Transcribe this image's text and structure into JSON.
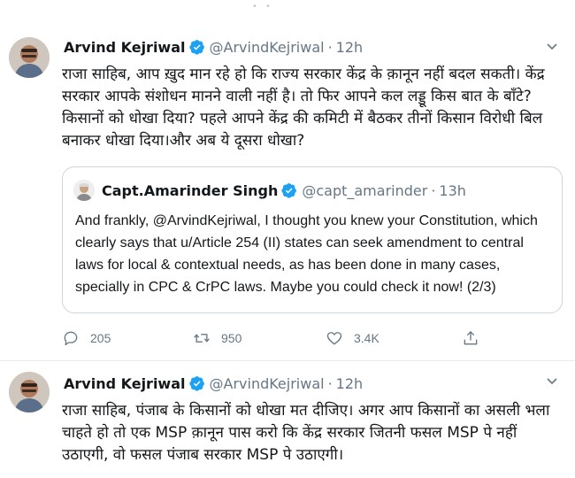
{
  "tweets": [
    {
      "author": "Arvind Kejriwal",
      "handle": "@ArvindKejriwal",
      "separator": "·",
      "time": "12h",
      "text": "राजा साहिब, आप ख़ुद मान रहे हो कि राज्य सरकार केंद्र के क़ानून नहीं बदल सकती। केंद्र सरकार आपके संशोधन मानने वाली नहीं है। तो फिर आपने कल लड्डू किस बात के बाँटे? किसानों को धोखा दिया? पहले आपने केंद्र की कमिटी में बैठकर तीनों किसान विरोधी बिल बनाकर धोखा दिया।और अब ये दूसरा धोखा?",
      "quoted": {
        "author": "Capt.Amarinder Singh",
        "handle": "@capt_amarinder",
        "separator": "·",
        "time": "13h",
        "text": "And frankly, @ArvindKejriwal, I thought you knew your Constitution, which clearly says that u/Article 254 (II) states can seek amendment to central laws for local & contextual needs, as has been done in many cases, specially in CPC & CrPC laws. Maybe you could check it now! (2/3)"
      },
      "actions": {
        "replies": "205",
        "retweets": "950",
        "likes": "3.4K"
      }
    },
    {
      "author": "Arvind Kejriwal",
      "handle": "@ArvindKejriwal",
      "separator": "·",
      "time": "12h",
      "text": "राजा साहिब, पंजाब के किसानों को धोखा मत दीजिए। अगर आप किसानों का असली भला चाहते हो तो एक MSP क़ानून पास करो कि केंद्र सरकार जितनी फसल MSP पे नहीं उठाएगी, वो फसल पंजाब सरकार MSP पे उठाएगी।"
    }
  ],
  "icons": {
    "verified": "verified-badge-icon",
    "caret": "chevron-down-icon",
    "reply": "reply-icon",
    "retweet": "retweet-icon",
    "like": "heart-icon",
    "share": "share-icon"
  },
  "colors": {
    "verified": "#1da1f2",
    "secondary_text": "#657786",
    "border": "#ccd6dd"
  }
}
